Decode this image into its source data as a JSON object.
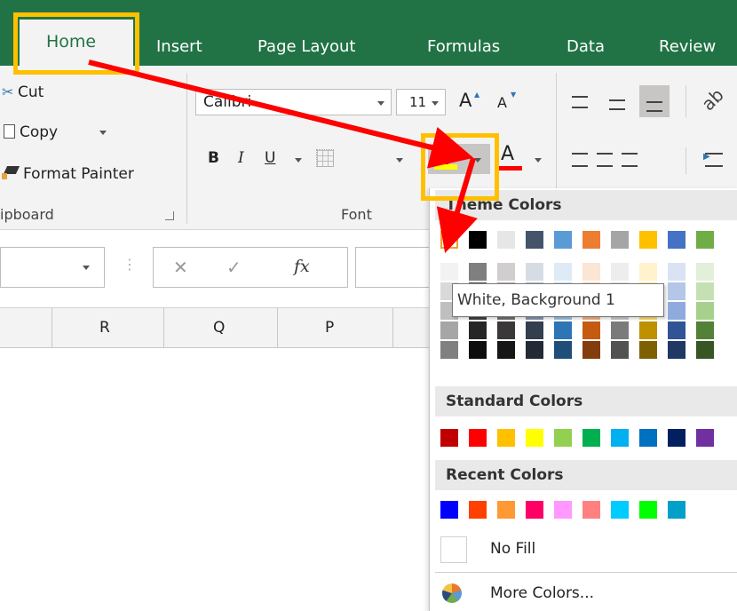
{
  "tabs": {
    "home": "Home",
    "insert": "Insert",
    "page_layout": "Page Layout",
    "formulas": "Formulas",
    "data": "Data",
    "review": "Review"
  },
  "clipboard": {
    "cut": "Cut",
    "copy": "Copy",
    "format_painter": "Format Painter",
    "group_label": "ipboard"
  },
  "font": {
    "name": "Calibri",
    "size": "11",
    "bold": "B",
    "italic": "I",
    "underline": "U",
    "font_color": "A",
    "grow": "A",
    "shrink": "A",
    "group_label": "Font",
    "highlight_color": "#ffff00",
    "font_color_bar": "#ff0000"
  },
  "formula_bar": {
    "cancel": "✕",
    "enter": "✓",
    "fx": "fx"
  },
  "columns": [
    "R",
    "Q",
    "P"
  ],
  "fill_menu": {
    "theme_header": "Theme Colors",
    "standard_header": "Standard Colors",
    "recent_header": "Recent Colors",
    "no_fill": "No Fill",
    "more_colors": "More Colors...",
    "tooltip": "White, Background 1",
    "theme_colors": [
      "#ffffff",
      "#000000",
      "#e7e6e6",
      "#44546a",
      "#5b9bd5",
      "#ed7d31",
      "#a5a5a5",
      "#ffc000",
      "#4472c4",
      "#70ad47"
    ],
    "theme_shades": [
      [
        "#f2f2f2",
        "#d9d9d9",
        "#bfbfbf",
        "#a6a6a6",
        "#808080"
      ],
      [
        "#7f7f7f",
        "#595959",
        "#404040",
        "#262626",
        "#0d0d0d"
      ],
      [
        "#d0cece",
        "#aeabab",
        "#757070",
        "#3a3838",
        "#171616"
      ],
      [
        "#d6dce4",
        "#adb9ca",
        "#8497b0",
        "#333f4f",
        "#222a35"
      ],
      [
        "#deebf6",
        "#bdd7ee",
        "#9dc3e6",
        "#2e75b6",
        "#1f4e79"
      ],
      [
        "#fbe5d5",
        "#f8cbad",
        "#f4b183",
        "#c55a11",
        "#833c0b"
      ],
      [
        "#ededed",
        "#dbdbdb",
        "#c9c9c9",
        "#7b7b7b",
        "#525252"
      ],
      [
        "#fff2cc",
        "#fee599",
        "#ffd966",
        "#bf9000",
        "#7f6000"
      ],
      [
        "#dae3f3",
        "#b4c7e7",
        "#8faadc",
        "#2f5597",
        "#1f3864"
      ],
      [
        "#e2efd9",
        "#c5e0b3",
        "#a8d08d",
        "#538135",
        "#375623"
      ]
    ],
    "standard_colors": [
      "#c00000",
      "#ff0000",
      "#ffc000",
      "#ffff00",
      "#92d050",
      "#00b050",
      "#00b0f0",
      "#0070c0",
      "#002060",
      "#7030a0"
    ],
    "recent_colors": [
      "#0000ff",
      "#ff4000",
      "#ff9933",
      "#ff0066",
      "#ff99ff",
      "#ff8080",
      "#00ccff",
      "#00ff00",
      "#00a0c8"
    ]
  },
  "annotations": {
    "highlight_color": "#ffc000",
    "arrow_color": "#ff0000"
  }
}
